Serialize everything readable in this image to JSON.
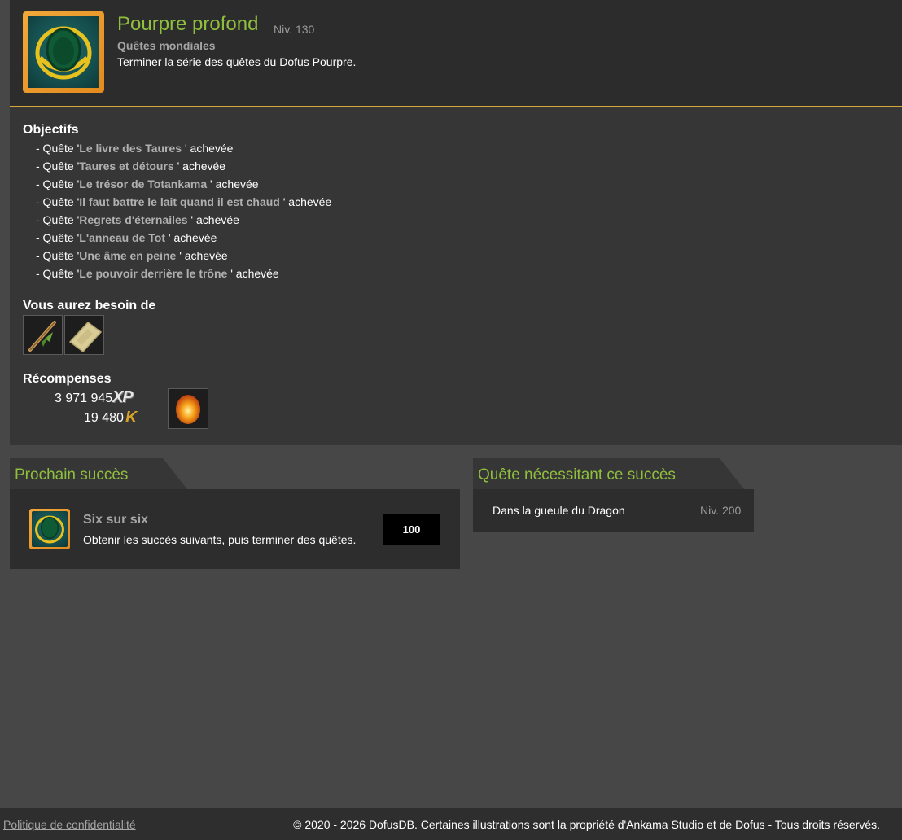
{
  "achievement": {
    "title": "Pourpre profond",
    "level": "Niv. 130",
    "category": "Quêtes mondiales",
    "description": "Terminer la série des quêtes du Dofus Pourpre.",
    "icon": "purple-egg-achievement-icon"
  },
  "objectives": {
    "heading": "Objectifs",
    "items": [
      {
        "prefix": "- Quête '",
        "name": "Le livre des Taures",
        "suffix": " ' achevée"
      },
      {
        "prefix": "- Quête '",
        "name": "Taures et détours",
        "suffix": " ' achevée"
      },
      {
        "prefix": "- Quête '",
        "name": "Le trésor de Totankama",
        "suffix": " ' achevée"
      },
      {
        "prefix": "- Quête '",
        "name": "Il faut battre le lait quand il est chaud",
        "suffix": " ' achevée"
      },
      {
        "prefix": "- Quête '",
        "name": "Regrets d'éternailes",
        "suffix": " ' achevée"
      },
      {
        "prefix": "- Quête '",
        "name": "L'anneau de Tot",
        "suffix": " ' achevée"
      },
      {
        "prefix": "- Quête '",
        "name": "Une âme en peine",
        "suffix": " ' achevée"
      },
      {
        "prefix": "- Quête '",
        "name": "Le pouvoir derrière le trône",
        "suffix": " ' achevée"
      }
    ]
  },
  "needs": {
    "heading": "Vous aurez besoin de",
    "items": [
      "wooden-staff-item-icon",
      "stone-tablet-item-icon"
    ]
  },
  "rewards": {
    "heading": "Récompenses",
    "xp": "3 971 945",
    "xp_label": "XP",
    "kamas": "19 480",
    "kamas_label": "K",
    "item": "fire-egg-item-icon"
  },
  "next_achievement": {
    "heading": "Prochain succès",
    "name": "Six sur six",
    "description": "Obtenir les succès suivants, puis terminer des quêtes.",
    "points": "100"
  },
  "required_quest": {
    "heading": "Quête nécessitant ce succès",
    "name": "Dans la gueule du Dragon",
    "level": "Niv. 200"
  },
  "footer": {
    "privacy": "Politique de confidentialité",
    "copyright": "© 2020 - 2026 DofusDB. Certaines illustrations sont la propriété d'Ankama Studio et de Dofus - Tous droits réservés."
  },
  "colors": {
    "accent_green": "#8fbf3c",
    "gold_border": "#d8a93a"
  }
}
